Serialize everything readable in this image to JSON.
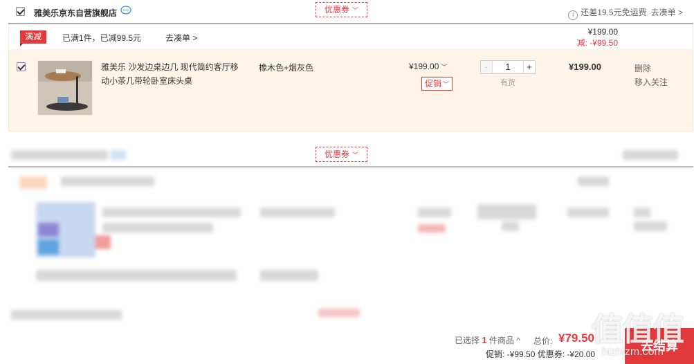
{
  "shop": {
    "name": "雅美乐京东自营旗舰店",
    "coupon_label": "优惠券",
    "shipping_text": "还差19.5元免运费",
    "shipping_link": "去凑单",
    "shipping_link_arrow": ">"
  },
  "promotion": {
    "tag": "满减",
    "text": "已满1件，已减99.5元",
    "link": "去凑单 >",
    "original_total": "¥199.00",
    "discount": "减: -¥99.50"
  },
  "item": {
    "title": "雅美乐 沙发边桌边几 现代简约客厅移动小茶几带轮卧室床头桌",
    "spec": "橡木色+烟灰色",
    "price": "¥199.00",
    "price_chevron": "﹀",
    "promo_label": "促销",
    "quantity": "1",
    "minus": "-",
    "plus": "+",
    "stock": "有货",
    "subtotal": "¥199.00",
    "delete": "删除",
    "move_to_follow": "移入关注"
  },
  "second_shop": {
    "coupon_label": "优惠券"
  },
  "footer": {
    "selected_prefix": "已选择",
    "selected_count": "1",
    "selected_suffix": "件商品",
    "selected_chevron": "^",
    "total_label": "总价:",
    "total": "¥79.50",
    "detail": "促销: -¥99.50 优惠券: -¥20.00",
    "checkout": "去结算"
  },
  "watermark": {
    "text": "值值值",
    "sub": "hizhizm.com"
  },
  "colors": {
    "accent": "#e4393c",
    "item_bg": "#fff4e8"
  }
}
